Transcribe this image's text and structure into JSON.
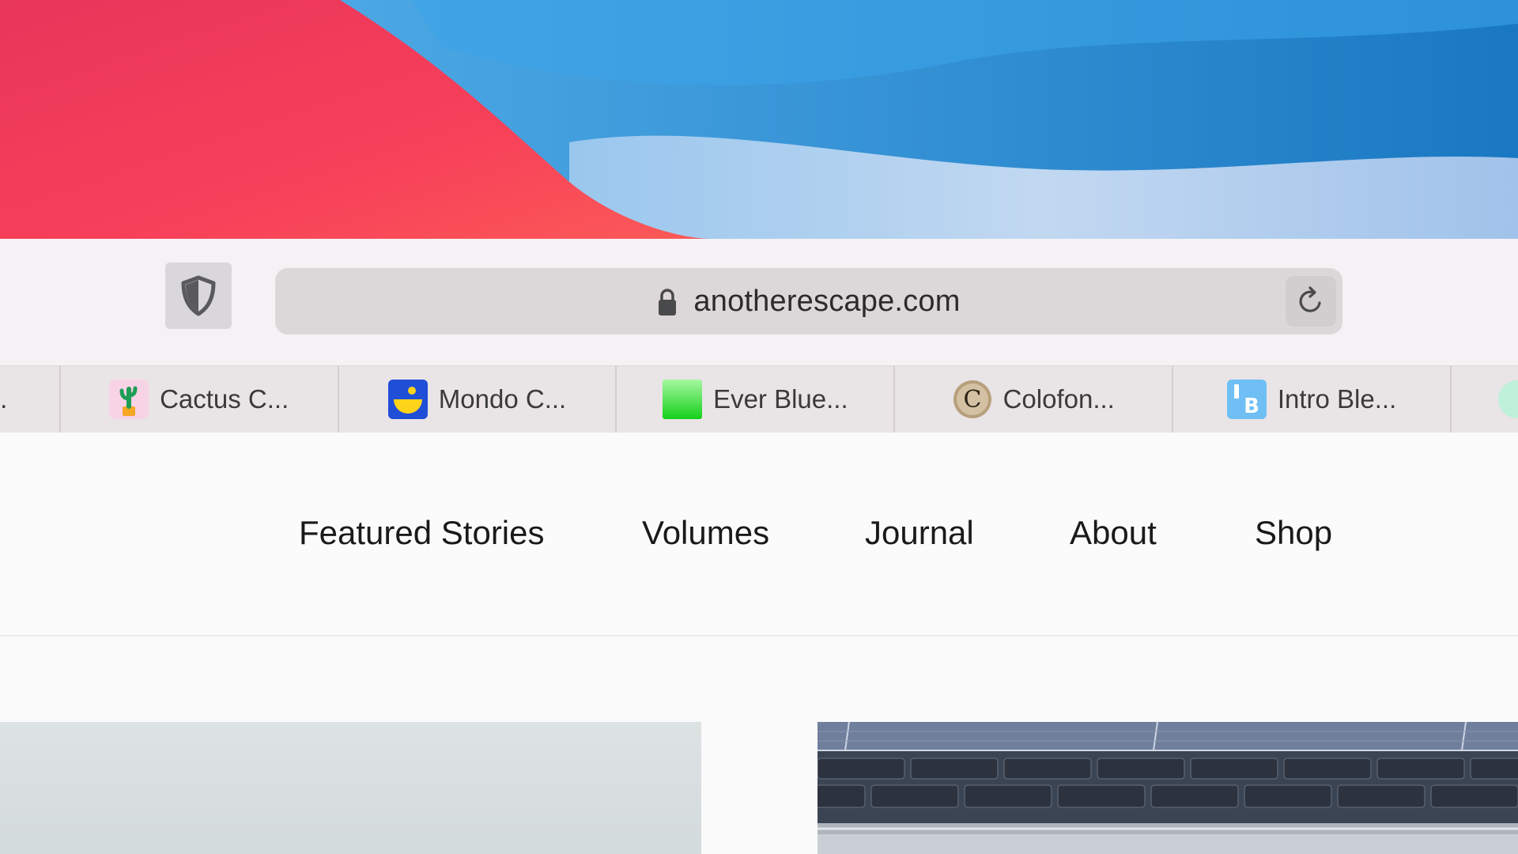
{
  "browser": {
    "url": "anotherescape.com",
    "favorites": [
      {
        "label": "Cactus C...",
        "icon": "cactus-icon"
      },
      {
        "label": "Mondo C...",
        "icon": "mondo-icon"
      },
      {
        "label": "Ever Blue...",
        "icon": "green-square-icon"
      },
      {
        "label": "Colofon...",
        "icon": "colofon-c-icon"
      },
      {
        "label": "Intro Ble...",
        "icon": "intro-b-icon"
      }
    ]
  },
  "site": {
    "nav": [
      "Featured Stories",
      "Volumes",
      "Journal",
      "About",
      "Shop"
    ]
  },
  "colors": {
    "wallpaper_red": "#f43f5e",
    "wallpaper_blue": "#1f86d0",
    "toolbar_bg": "#f4f2f4",
    "address_bar_bg": "#dcd8da"
  }
}
